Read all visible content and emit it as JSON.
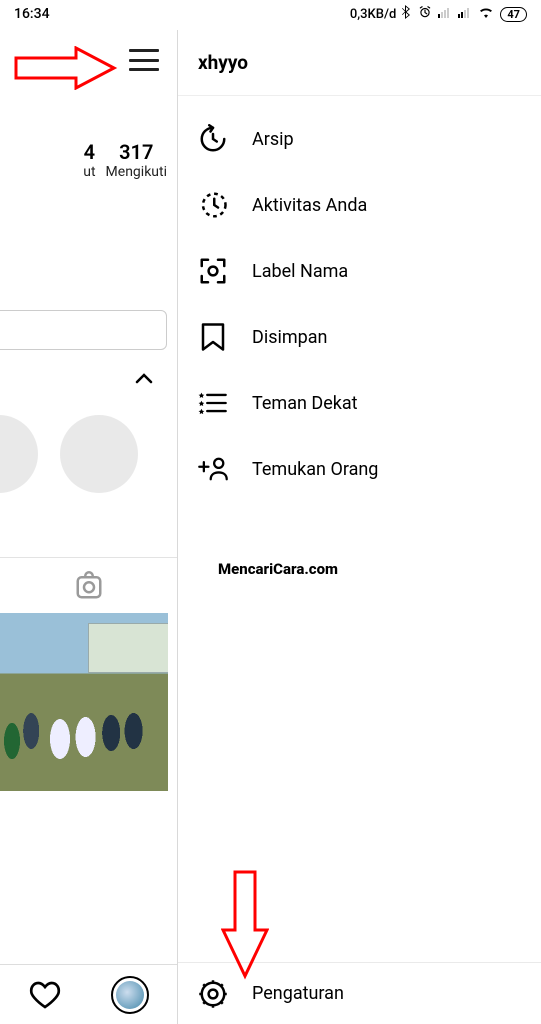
{
  "status_bar": {
    "time": "16:34",
    "data_rate": "0,3KB/d",
    "battery": "47"
  },
  "profile": {
    "stat1_num": "4",
    "stat1_label": "ut",
    "stat2_num": "317",
    "stat2_label": "Mengikuti"
  },
  "drawer": {
    "username": "xhyyo",
    "items": [
      {
        "label": "Arsip"
      },
      {
        "label": "Aktivitas Anda"
      },
      {
        "label": "Label Nama"
      },
      {
        "label": "Disimpan"
      },
      {
        "label": "Teman Dekat"
      },
      {
        "label": "Temukan Orang"
      }
    ],
    "settings_label": "Pengaturan"
  },
  "watermark": "MencariCara.com"
}
